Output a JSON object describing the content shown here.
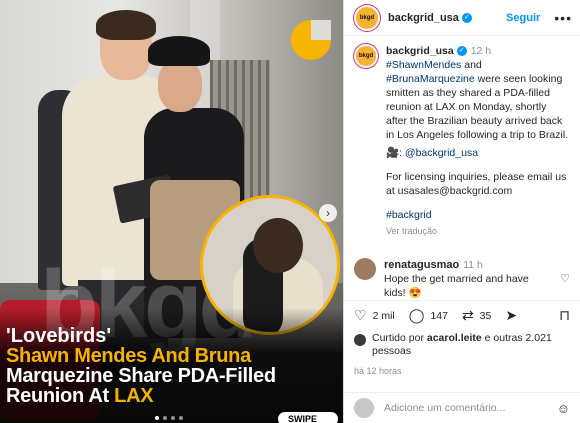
{
  "media": {
    "headline_line1": "'Lovebirds'",
    "headline_line2_a": "Shawn Mendes And ",
    "headline_line2_b": "Bruna",
    "headline_line3": "Marquezine Share PDA-Filled",
    "headline_line4_a": "Reunion At ",
    "headline_line4_b": "LAX",
    "swipe_label": "SWIPE",
    "watermark": "bkgd",
    "carousel_dots": 4,
    "active_dot": 0,
    "next_icon": "chevron-right-icon",
    "accent_color": "#f6b400"
  },
  "header": {
    "avatar_text": "bkgd",
    "username": "backgrid_usa",
    "follow_label": "Seguir",
    "more_icon": "ellipsis-icon"
  },
  "caption": {
    "username": "backgrid_usa",
    "time": "12 h",
    "tag1": "#ShawnMendes",
    "and_word": " and ",
    "tag2": "#BrunaMarquezine",
    "text1": " were seen looking smitten as they shared a PDA-filled reunion at LAX on Monday, shortly after the Brazilian beauty arrived back in Los Angeles following a trip to Brazil.",
    "credit_icon": "🎥",
    "credit_text": ": @backgrid_usa",
    "licensing": "For licensing inquiries, please email us at usasales@backgrid.com",
    "hashtag": "#backgrid",
    "see_translation": "Ver tradução"
  },
  "comment": {
    "username": "renatagusmao",
    "time": "11 h",
    "text": "Hope the get married and have kids! 😍",
    "heart_icon": "heart-outline-icon"
  },
  "actions": {
    "like_count": "2 mil",
    "comment_count": "147",
    "share_count": "35"
  },
  "liked_by": {
    "prefix": "Curtido por ",
    "user": "acarol.leite",
    "suffix": " e outras 2.021 pessoas"
  },
  "posted_ago": "há 12 horas",
  "add_comment": {
    "placeholder": "Adicione um comentário..."
  }
}
